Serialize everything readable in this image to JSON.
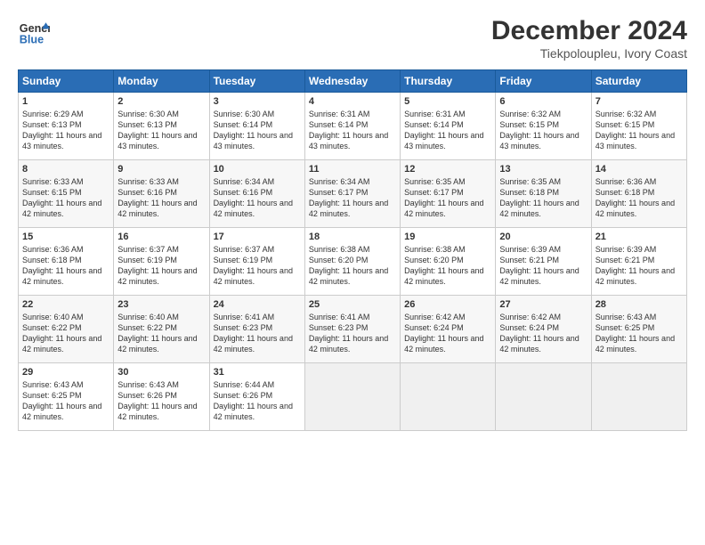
{
  "logo": {
    "general": "General",
    "blue": "Blue"
  },
  "title": "December 2024",
  "subtitle": "Tiekpoloupleu, Ivory Coast",
  "days_header": [
    "Sunday",
    "Monday",
    "Tuesday",
    "Wednesday",
    "Thursday",
    "Friday",
    "Saturday"
  ],
  "weeks": [
    [
      {
        "day": "1",
        "sunrise": "6:29 AM",
        "sunset": "6:13 PM",
        "daylight": "11 hours and 43 minutes."
      },
      {
        "day": "2",
        "sunrise": "6:30 AM",
        "sunset": "6:13 PM",
        "daylight": "11 hours and 43 minutes."
      },
      {
        "day": "3",
        "sunrise": "6:30 AM",
        "sunset": "6:14 PM",
        "daylight": "11 hours and 43 minutes."
      },
      {
        "day": "4",
        "sunrise": "6:31 AM",
        "sunset": "6:14 PM",
        "daylight": "11 hours and 43 minutes."
      },
      {
        "day": "5",
        "sunrise": "6:31 AM",
        "sunset": "6:14 PM",
        "daylight": "11 hours and 43 minutes."
      },
      {
        "day": "6",
        "sunrise": "6:32 AM",
        "sunset": "6:15 PM",
        "daylight": "11 hours and 43 minutes."
      },
      {
        "day": "7",
        "sunrise": "6:32 AM",
        "sunset": "6:15 PM",
        "daylight": "11 hours and 43 minutes."
      }
    ],
    [
      {
        "day": "8",
        "sunrise": "6:33 AM",
        "sunset": "6:15 PM",
        "daylight": "11 hours and 42 minutes."
      },
      {
        "day": "9",
        "sunrise": "6:33 AM",
        "sunset": "6:16 PM",
        "daylight": "11 hours and 42 minutes."
      },
      {
        "day": "10",
        "sunrise": "6:34 AM",
        "sunset": "6:16 PM",
        "daylight": "11 hours and 42 minutes."
      },
      {
        "day": "11",
        "sunrise": "6:34 AM",
        "sunset": "6:17 PM",
        "daylight": "11 hours and 42 minutes."
      },
      {
        "day": "12",
        "sunrise": "6:35 AM",
        "sunset": "6:17 PM",
        "daylight": "11 hours and 42 minutes."
      },
      {
        "day": "13",
        "sunrise": "6:35 AM",
        "sunset": "6:18 PM",
        "daylight": "11 hours and 42 minutes."
      },
      {
        "day": "14",
        "sunrise": "6:36 AM",
        "sunset": "6:18 PM",
        "daylight": "11 hours and 42 minutes."
      }
    ],
    [
      {
        "day": "15",
        "sunrise": "6:36 AM",
        "sunset": "6:18 PM",
        "daylight": "11 hours and 42 minutes."
      },
      {
        "day": "16",
        "sunrise": "6:37 AM",
        "sunset": "6:19 PM",
        "daylight": "11 hours and 42 minutes."
      },
      {
        "day": "17",
        "sunrise": "6:37 AM",
        "sunset": "6:19 PM",
        "daylight": "11 hours and 42 minutes."
      },
      {
        "day": "18",
        "sunrise": "6:38 AM",
        "sunset": "6:20 PM",
        "daylight": "11 hours and 42 minutes."
      },
      {
        "day": "19",
        "sunrise": "6:38 AM",
        "sunset": "6:20 PM",
        "daylight": "11 hours and 42 minutes."
      },
      {
        "day": "20",
        "sunrise": "6:39 AM",
        "sunset": "6:21 PM",
        "daylight": "11 hours and 42 minutes."
      },
      {
        "day": "21",
        "sunrise": "6:39 AM",
        "sunset": "6:21 PM",
        "daylight": "11 hours and 42 minutes."
      }
    ],
    [
      {
        "day": "22",
        "sunrise": "6:40 AM",
        "sunset": "6:22 PM",
        "daylight": "11 hours and 42 minutes."
      },
      {
        "day": "23",
        "sunrise": "6:40 AM",
        "sunset": "6:22 PM",
        "daylight": "11 hours and 42 minutes."
      },
      {
        "day": "24",
        "sunrise": "6:41 AM",
        "sunset": "6:23 PM",
        "daylight": "11 hours and 42 minutes."
      },
      {
        "day": "25",
        "sunrise": "6:41 AM",
        "sunset": "6:23 PM",
        "daylight": "11 hours and 42 minutes."
      },
      {
        "day": "26",
        "sunrise": "6:42 AM",
        "sunset": "6:24 PM",
        "daylight": "11 hours and 42 minutes."
      },
      {
        "day": "27",
        "sunrise": "6:42 AM",
        "sunset": "6:24 PM",
        "daylight": "11 hours and 42 minutes."
      },
      {
        "day": "28",
        "sunrise": "6:43 AM",
        "sunset": "6:25 PM",
        "daylight": "11 hours and 42 minutes."
      }
    ],
    [
      {
        "day": "29",
        "sunrise": "6:43 AM",
        "sunset": "6:25 PM",
        "daylight": "11 hours and 42 minutes."
      },
      {
        "day": "30",
        "sunrise": "6:43 AM",
        "sunset": "6:26 PM",
        "daylight": "11 hours and 42 minutes."
      },
      {
        "day": "31",
        "sunrise": "6:44 AM",
        "sunset": "6:26 PM",
        "daylight": "11 hours and 42 minutes."
      },
      null,
      null,
      null,
      null
    ]
  ]
}
